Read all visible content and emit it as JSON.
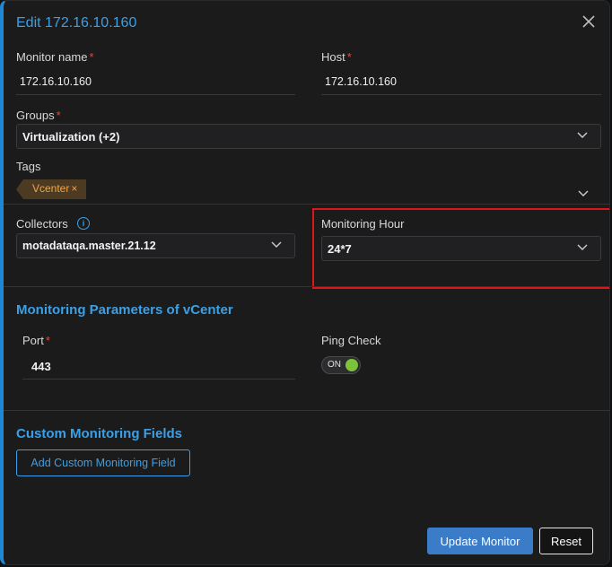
{
  "dialog": {
    "title": "Edit 172.16.10.160"
  },
  "fields": {
    "monitor_name": {
      "label": "Monitor name",
      "required_mark": "*",
      "value": "172.16.10.160"
    },
    "host": {
      "label": "Host",
      "required_mark": "*",
      "value": "172.16.10.160"
    },
    "groups": {
      "label": "Groups",
      "required_mark": "*",
      "value": "Virtualization (+2)"
    },
    "tags": {
      "label": "Tags",
      "items": [
        {
          "label": "Vcenter",
          "remove": "×"
        }
      ]
    },
    "collectors": {
      "label": "Collectors",
      "info": "i",
      "value": "motadataqa.master.21.12"
    },
    "monitoring_hour": {
      "label": "Monitoring Hour",
      "value": "24*7"
    }
  },
  "monitoring_parameters": {
    "title": "Monitoring Parameters of vCenter",
    "port": {
      "label": "Port",
      "required_mark": "*",
      "value": "443"
    },
    "ping_check": {
      "label": "Ping Check",
      "state": "ON"
    }
  },
  "custom_fields": {
    "title": "Custom Monitoring Fields",
    "add_button": "Add Custom Monitoring Field"
  },
  "footer": {
    "update_button": "Update Monitor",
    "reset_button": "Reset"
  },
  "colors": {
    "accent": "#3aa0e8",
    "primary_button": "#3a7cc8",
    "required": "#e2483d",
    "tag_text": "#f0a64a",
    "toggle_on": "#7cc23a",
    "highlight": "#e01515"
  }
}
